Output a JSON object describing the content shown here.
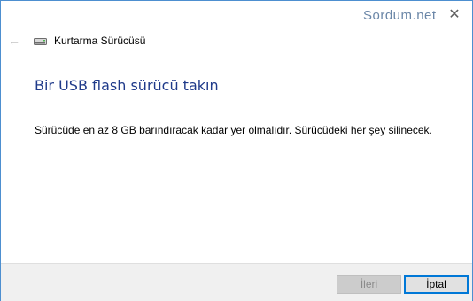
{
  "window": {
    "watermark": "Sordum.net",
    "title": "Kurtarma Sürücüsü",
    "close_glyph": "✕",
    "back_glyph": "←",
    "app_icon": "usb-drive-icon"
  },
  "content": {
    "heading": "Bir USB flash sürücü takın",
    "description": "Sürücüde en az 8 GB barındıracak kadar yer olmalıdır. Sürücüdeki her şey silinecek."
  },
  "footer": {
    "next_label": "İleri",
    "cancel_label": "İptal"
  },
  "colors": {
    "accent": "#0078d7",
    "heading": "#1f3a8a",
    "footer_bg": "#f0f0f0"
  }
}
